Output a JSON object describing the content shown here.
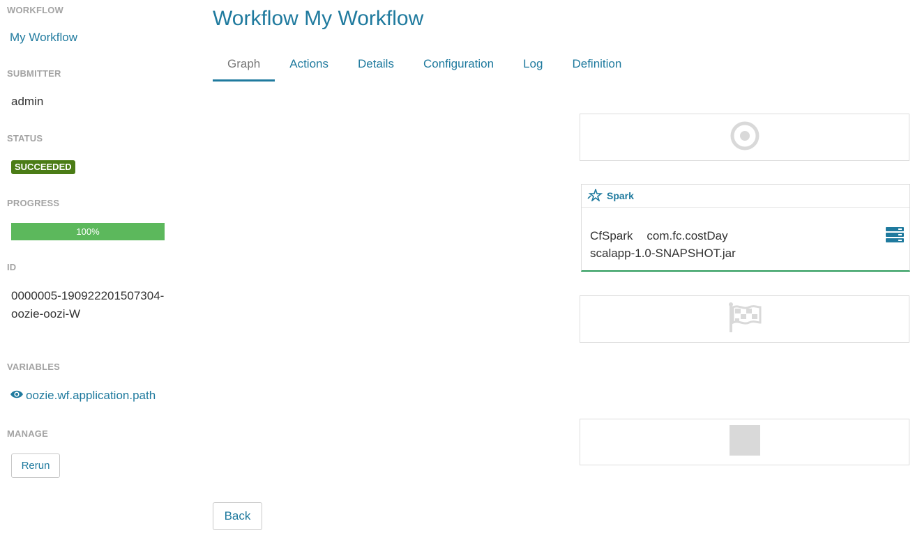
{
  "sidebar": {
    "workflow_heading": "WORKFLOW",
    "workflow_name": "My Workflow",
    "submitter_heading": "SUBMITTER",
    "submitter": "admin",
    "status_heading": "STATUS",
    "status": "SUCCEEDED",
    "progress_heading": "PROGRESS",
    "progress_label": "100%",
    "progress_value": 100,
    "id_heading": "ID",
    "id": "0000005-190922201507304-oozie-oozi-W",
    "variables_heading": "VARIABLES",
    "variable_link": "oozie.wf.application.path",
    "manage_heading": "MANAGE",
    "rerun_label": "Rerun"
  },
  "main": {
    "title": "Workflow My Workflow",
    "tabs": [
      {
        "label": "Graph",
        "active": true
      },
      {
        "label": "Actions",
        "active": false
      },
      {
        "label": "Details",
        "active": false
      },
      {
        "label": "Configuration",
        "active": false
      },
      {
        "label": "Log",
        "active": false
      },
      {
        "label": "Definition",
        "active": false
      }
    ],
    "back_label": "Back"
  },
  "graph": {
    "start_icon": "target-icon",
    "spark_node": {
      "type_label": "Spark",
      "name": "CfSpark",
      "class": "com.fc.costDay",
      "jar": "scalapp-1.0-SNAPSHOT.jar"
    },
    "end_icon": "checkered-flag-icon",
    "kill_icon": "stop-square-icon"
  },
  "colors": {
    "accent": "#1f7a9e",
    "status_success": "#4b7c16",
    "progress": "#5cb85c",
    "node_icon": "#d9d9d9"
  }
}
